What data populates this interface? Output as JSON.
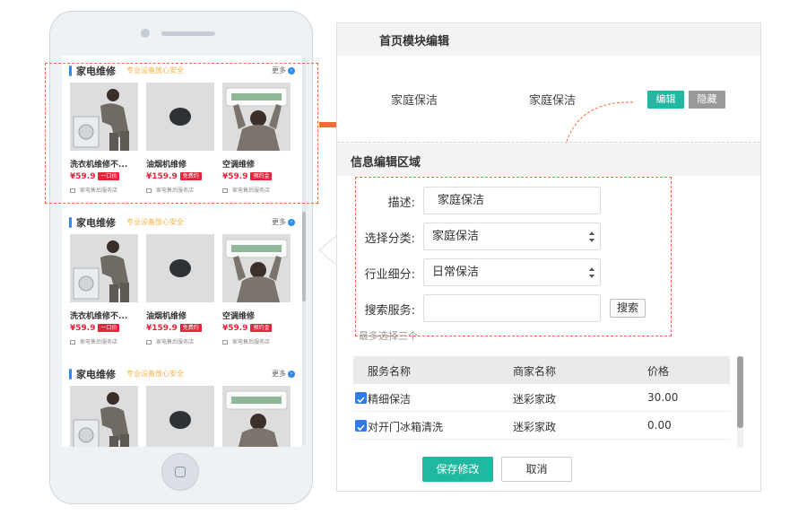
{
  "phone": {
    "modules": [
      {
        "title": "家电维修",
        "subtitle": "专业设备放心安全",
        "more": "更多",
        "items": [
          {
            "name": "洗衣机维修不...",
            "price": "¥59.9",
            "tag": "一口价",
            "shop": "家电售后服务店"
          },
          {
            "name": "油烟机维修",
            "price": "¥159.9",
            "tag": "免费约",
            "shop": "家电售后服务店"
          },
          {
            "name": "空调维修",
            "price": "¥59.9",
            "tag": "预约金",
            "shop": "家电售后服务店"
          }
        ]
      },
      {
        "title": "家电维修",
        "subtitle": "专业设备放心安全",
        "more": "更多",
        "items": [
          {
            "name": "洗衣机维修不...",
            "price": "¥59.9",
            "tag": "一口价",
            "shop": "家电售后服务店"
          },
          {
            "name": "油烟机维修",
            "price": "¥159.9",
            "tag": "免费约",
            "shop": "家电售后服务店"
          },
          {
            "name": "空调维修",
            "price": "¥59.9",
            "tag": "预约金",
            "shop": "家电售后服务店"
          }
        ]
      },
      {
        "title": "家电维修",
        "subtitle": "专业设备放心安全",
        "more": "更多",
        "items": [
          {
            "name": "",
            "price": "",
            "tag": "",
            "shop": ""
          },
          {
            "name": "",
            "price": "",
            "tag": "",
            "shop": ""
          },
          {
            "name": "",
            "price": "",
            "tag": "",
            "shop": ""
          }
        ]
      }
    ]
  },
  "editor": {
    "title": "首页模块编辑",
    "modules": [
      "家庭保洁",
      "家庭保洁"
    ],
    "edit_label": "编辑",
    "hide_label": "隐藏",
    "info_title": "信息编辑区域",
    "form": {
      "desc_label": "描述:",
      "desc_value": "家庭保洁",
      "category_label": "选择分类:",
      "category_value": "家庭保洁",
      "subcategory_label": "行业细分:",
      "subcategory_value": "日常保洁",
      "search_label": "搜索服务:",
      "search_value": "",
      "search_button": "搜索",
      "hint": "最多选择三个"
    },
    "table": {
      "headers": [
        "服务名称",
        "商家名称",
        "价格"
      ],
      "rows": [
        {
          "service": "精细保洁",
          "merchant": "迷彩家政",
          "price": "30.00",
          "checked": true
        },
        {
          "service": "对开门冰箱清洗",
          "merchant": "迷彩家政",
          "price": "0.00",
          "checked": true
        }
      ]
    },
    "save_label": "保存修改",
    "cancel_label": "取消"
  },
  "colors": {
    "accent": "#20b8a0",
    "price_red": "#e3263c",
    "selection_orange": "#f06c3a",
    "title_blue": "#2d8cf0"
  }
}
